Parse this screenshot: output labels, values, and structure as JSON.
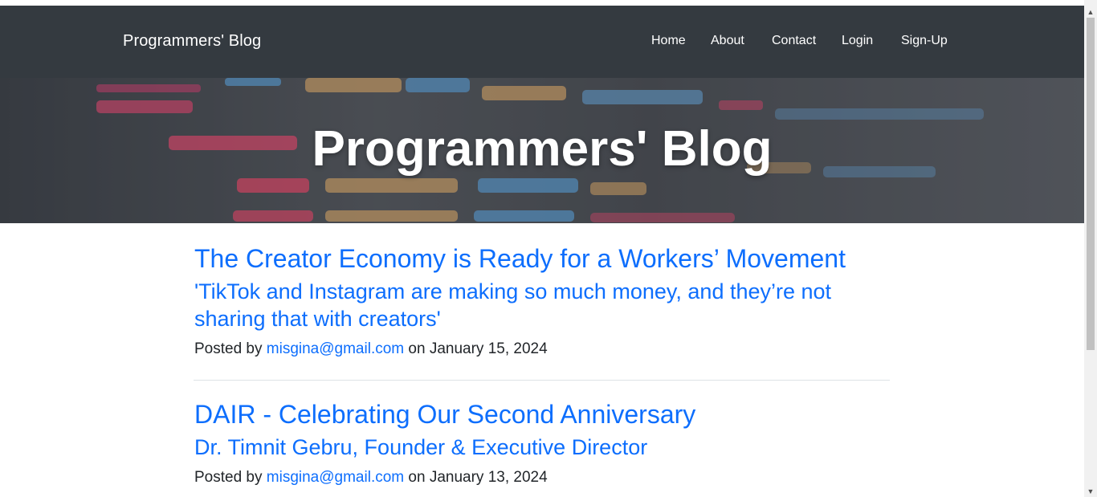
{
  "nav": {
    "brand": "Programmers' Blog",
    "links": [
      "Home",
      "About",
      "Contact",
      "Login",
      "Sign-Up"
    ]
  },
  "hero": {
    "title": "Programmers' Blog"
  },
  "posts": [
    {
      "title": "The Creator Economy is Ready for a Workers’ Movement",
      "subtitle": "'TikTok and Instagram are making so much money, and they’re not sharing that with creators'",
      "posted_by_prefix": "Posted by",
      "author": "misgina@gmail.com",
      "date_text": "on January 15, 2024"
    },
    {
      "title": "DAIR - Celebrating Our Second Anniversary",
      "subtitle": "Dr. Timnit Gebru, Founder & Executive Director",
      "posted_by_prefix": "Posted by",
      "author": "misgina@gmail.com",
      "date_text": "on January 13, 2024"
    }
  ],
  "colors": {
    "navbar_bg": "#343a40",
    "link": "#0d6efd",
    "text": "#212529"
  },
  "icons": {
    "scroll_up": "triangle-up",
    "scroll_down": "triangle-down"
  }
}
